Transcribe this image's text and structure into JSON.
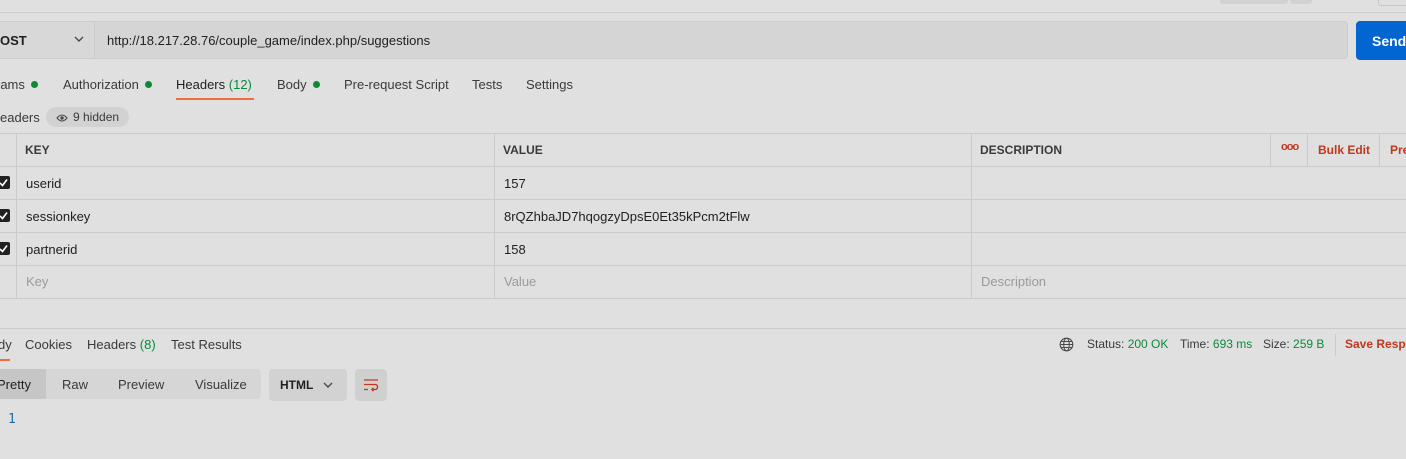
{
  "request": {
    "method": "OST",
    "url": "http://18.217.28.76/couple_game/index.php/suggestions",
    "send_label": "Send"
  },
  "request_tabs": [
    {
      "label": "rams",
      "count": "",
      "dot": true
    },
    {
      "label": "Authorization",
      "count": "",
      "dot": true
    },
    {
      "label": "Headers",
      "count": "(12)",
      "dot": false,
      "active": true
    },
    {
      "label": "Body",
      "count": "",
      "dot": true
    },
    {
      "label": "Pre-request Script",
      "count": "",
      "dot": false
    },
    {
      "label": "Tests",
      "count": "",
      "dot": false
    },
    {
      "label": "Settings",
      "count": "",
      "dot": false
    }
  ],
  "headers_section": {
    "label": "eaders",
    "hidden_label": "9 hidden"
  },
  "table": {
    "columns": [
      "KEY",
      "VALUE",
      "DESCRIPTION"
    ],
    "more_label": "ooo",
    "bulk_edit_label": "Bulk Edit",
    "presets_label": "Pre",
    "rows": [
      {
        "key": "userid",
        "value": "157",
        "description": "",
        "checked": true
      },
      {
        "key": "sessionkey",
        "value": "8rQZhbaJD7hqogzyDpsE0Et35kPcm2tFlw",
        "description": "",
        "checked": true
      },
      {
        "key": "partnerid",
        "value": "158",
        "description": "",
        "checked": true
      }
    ],
    "placeholders": {
      "key": "Key",
      "value": "Value",
      "description": "Description"
    }
  },
  "response_tabs": [
    {
      "label": "dy",
      "count": ""
    },
    {
      "label": "Cookies",
      "count": ""
    },
    {
      "label": "Headers",
      "count": "(8)"
    },
    {
      "label": "Test Results",
      "count": ""
    }
  ],
  "response_status": {
    "status_label": "Status:",
    "status_value": "200 OK",
    "time_label": "Time:",
    "time_value": "693 ms",
    "size_label": "Size:",
    "size_value": "259 B",
    "save_label": "Save Resp"
  },
  "view_modes": [
    "Pretty",
    "Raw",
    "Preview",
    "Visualize"
  ],
  "format": "HTML",
  "body_lines": [
    "1"
  ],
  "colors": {
    "accent_orange": "#f26b3a",
    "send_blue": "#0265d2",
    "success_green": "#0b8a3c",
    "link_red": "#c1381d"
  },
  "icons": [
    "chevron-down-icon",
    "eye-icon",
    "checkbox-icon",
    "more-icon",
    "globe-icon",
    "wrap-lines-icon"
  ]
}
